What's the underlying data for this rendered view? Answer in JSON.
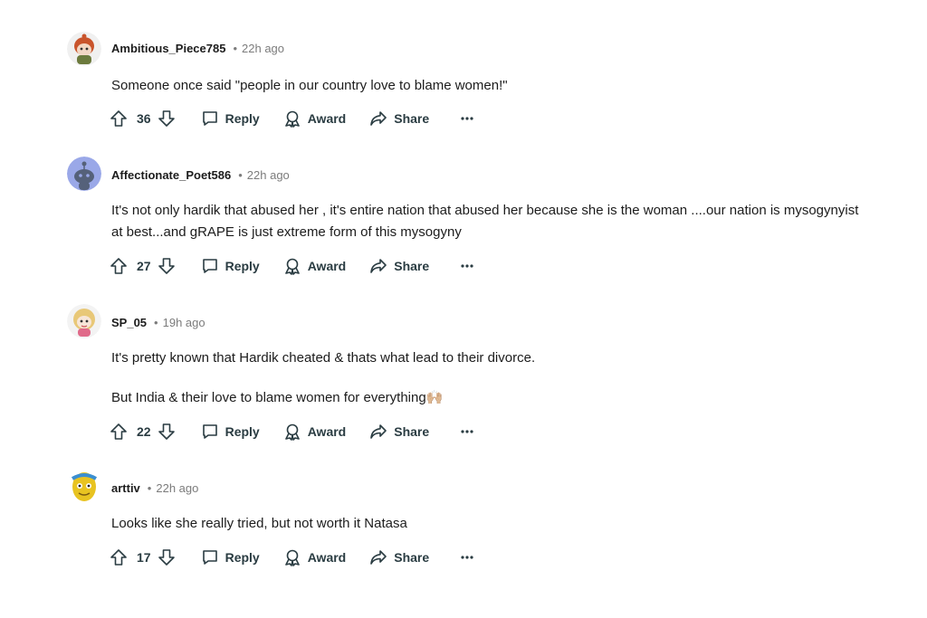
{
  "comments": [
    {
      "author": "Ambitious_Piece785",
      "time": "22h ago",
      "paragraphs": [
        "Someone once said \"people in our country love to blame women!\""
      ],
      "votes": "36",
      "reply_label": "Reply",
      "award_label": "Award",
      "share_label": "Share",
      "avatar": "snoo-red-hair-avatar"
    },
    {
      "author": "Affectionate_Poet586",
      "time": "22h ago",
      "paragraphs": [
        "It's not only hardik that abused her , it's entire nation that abused her because she is the woman ....our nation is mysogynyist at best...and gRAPE is just extreme form of this mysogyny"
      ],
      "votes": "27",
      "reply_label": "Reply",
      "award_label": "Award",
      "share_label": "Share",
      "avatar": "default-snoo-blue-avatar"
    },
    {
      "author": "SP_05",
      "time": "19h ago",
      "paragraphs": [
        "It's pretty known that Hardik cheated & thats what lead to their divorce.",
        "But India & their love to blame women for everything🙌🏼"
      ],
      "votes": "22",
      "reply_label": "Reply",
      "award_label": "Award",
      "share_label": "Share",
      "avatar": "snoo-blonde-avatar"
    },
    {
      "author": "arttiv",
      "time": "22h ago",
      "paragraphs": [
        "Looks like she really tried, but not worth it Natasa"
      ],
      "votes": "17",
      "reply_label": "Reply",
      "award_label": "Award",
      "share_label": "Share",
      "avatar": "snoo-yellow-avatar"
    }
  ],
  "icons": {
    "upvote": "upvote-arrow-icon",
    "downvote": "downvote-arrow-icon",
    "reply": "speech-bubble-icon",
    "award": "award-ribbon-icon",
    "share": "share-arrow-icon",
    "more": "ellipsis-icon"
  },
  "colors": {
    "text": "#1c1c1c",
    "meta": "#7c7c7c",
    "actions": "#2a3c42"
  }
}
